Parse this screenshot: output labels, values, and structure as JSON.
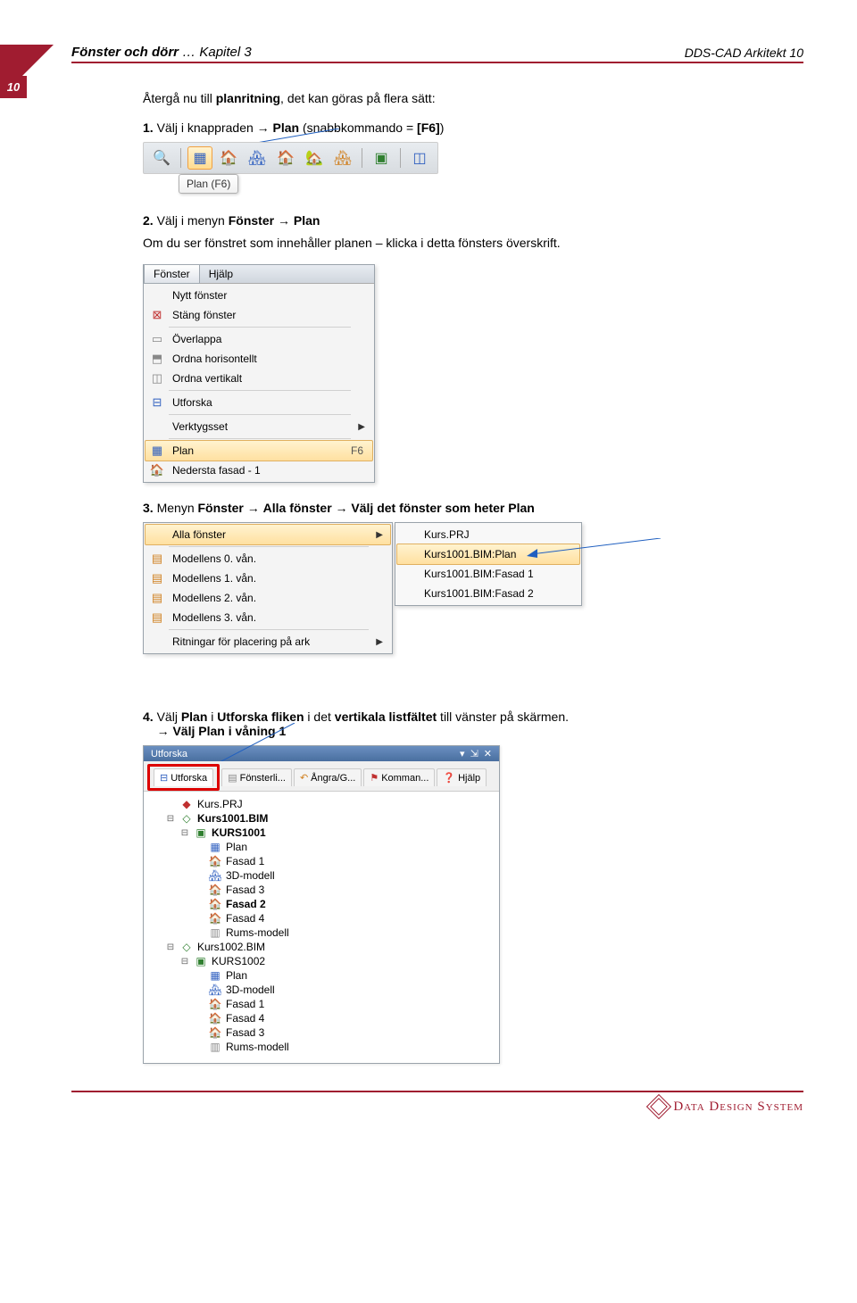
{
  "page_number": "10",
  "header": {
    "left_bold": "Fönster och dörr",
    "left_rest": " … Kapitel 3",
    "right": "DDS-CAD Arkitekt 10"
  },
  "intro": {
    "prefix": "Återgå nu till ",
    "bold": "planritning",
    "suffix": ", det kan göras på flera sätt:"
  },
  "step1": {
    "num": "1.",
    "t1": "Välj i knappraden → ",
    "b1": "Plan",
    "t2": " (snabbkommando = ",
    "b2": "[F6]",
    "t3": ")"
  },
  "toolbar": {
    "tooltip": "Plan (F6)"
  },
  "step2": {
    "num": "2.",
    "t1": "Välj i menyn ",
    "b1": "Fönster",
    "arrow": " → ",
    "b2": "Plan",
    "line2": "Om du ser fönstret som innehåller planen – klicka i detta fönsters överskrift."
  },
  "menu1": {
    "bar": [
      "Fönster",
      "Hjälp"
    ],
    "items": [
      {
        "label": "Nytt fönster"
      },
      {
        "label": "Stäng fönster"
      },
      {
        "sep": true
      },
      {
        "label": "Överlappa"
      },
      {
        "label": "Ordna horisontellt"
      },
      {
        "label": "Ordna vertikalt"
      },
      {
        "sep": true
      },
      {
        "label": "Utforska"
      },
      {
        "sep": true
      },
      {
        "label": "Verktygsset",
        "submenu": true
      },
      {
        "sep": true
      },
      {
        "label": "Plan",
        "shortcut": "F6",
        "selected": true
      },
      {
        "label": "Nedersta fasad - 1"
      }
    ]
  },
  "step3": {
    "num": "3.",
    "t1": "Menyn ",
    "b1": "Fönster",
    "a1": "  → ",
    "b2": "Alla fönster",
    "a2": " → ",
    "b3": "Välj det fönster som heter Plan"
  },
  "cascade_left": [
    {
      "label": "Alla fönster",
      "submenu": true,
      "selected": true
    },
    {
      "sep": true
    },
    {
      "label": "Modellens 0. vån."
    },
    {
      "label": "Modellens 1. vån."
    },
    {
      "label": "Modellens 2. vån."
    },
    {
      "label": "Modellens 3. vån."
    },
    {
      "sep": true
    },
    {
      "label": "Ritningar för placering på ark",
      "submenu": true
    }
  ],
  "cascade_right": [
    {
      "label": "Kurs.PRJ"
    },
    {
      "label": "Kurs1001.BIM:Plan",
      "selected": true
    },
    {
      "label": "Kurs1001.BIM:Fasad 1"
    },
    {
      "label": "Kurs1001.BIM:Fasad 2"
    }
  ],
  "step4": {
    "num": "4.",
    "t1": "Välj ",
    "b1": "Plan",
    "t2": " i ",
    "b2": "Utforska fliken",
    "t3": " i det ",
    "b3": "vertikala listfältet",
    "t4": " till vänster på skärmen.",
    "line2_arrow": "→ ",
    "line2_b": "Välj Plan i våning 1"
  },
  "explorer": {
    "title": "Utforska",
    "tabs": [
      "Utforska",
      "Fönsterli...",
      "Ångra/G...",
      "Komman...",
      "Hjälp"
    ],
    "tree": [
      {
        "indent": 1,
        "label": "Kurs.PRJ",
        "ico": "prj"
      },
      {
        "indent": 1,
        "label": "Kurs1001.BIM",
        "ico": "bim",
        "bold": true,
        "toggle": "-"
      },
      {
        "indent": 2,
        "label": "KURS1001",
        "ico": "folder",
        "bold": true,
        "toggle": "-"
      },
      {
        "indent": 3,
        "label": "Plan",
        "ico": "plan"
      },
      {
        "indent": 3,
        "label": "Fasad 1",
        "ico": "fasad"
      },
      {
        "indent": 3,
        "label": "3D-modell",
        "ico": "3d"
      },
      {
        "indent": 3,
        "label": "Fasad 3",
        "ico": "fasad"
      },
      {
        "indent": 3,
        "label": "Fasad 2",
        "ico": "fasad",
        "bold": true
      },
      {
        "indent": 3,
        "label": "Fasad 4",
        "ico": "fasad"
      },
      {
        "indent": 3,
        "label": "Rums-modell",
        "ico": "room"
      },
      {
        "indent": 1,
        "label": "Kurs1002.BIM",
        "ico": "bim",
        "toggle": "-"
      },
      {
        "indent": 2,
        "label": "KURS1002",
        "ico": "folder",
        "toggle": "-"
      },
      {
        "indent": 3,
        "label": "Plan",
        "ico": "plan"
      },
      {
        "indent": 3,
        "label": "3D-modell",
        "ico": "3d"
      },
      {
        "indent": 3,
        "label": "Fasad 1",
        "ico": "fasad"
      },
      {
        "indent": 3,
        "label": "Fasad 4",
        "ico": "fasad"
      },
      {
        "indent": 3,
        "label": "Fasad 3",
        "ico": "fasad"
      },
      {
        "indent": 3,
        "label": "Rums-modell",
        "ico": "room"
      }
    ]
  },
  "footer": {
    "brand": "Data Design System"
  }
}
